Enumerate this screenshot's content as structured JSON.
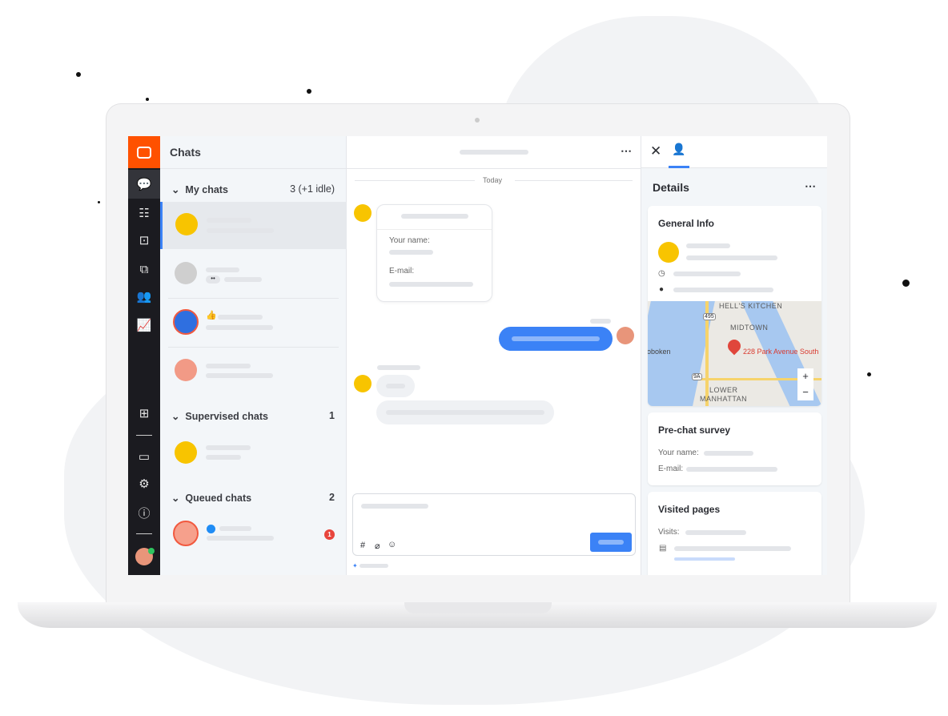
{
  "sidebar_nav": {
    "items": [
      "chats-icon",
      "list-icon",
      "inbox-icon",
      "ticket-icon",
      "team-icon",
      "reports-icon",
      "apps-icon",
      "billing-icon",
      "settings-icon",
      "help-icon"
    ],
    "accent": "#ff5100"
  },
  "chats": {
    "title": "Chats",
    "my_chats": {
      "label": "My chats",
      "count": "3 (+1 idle)"
    },
    "supervised": {
      "label": "Supervised chats",
      "count": "1"
    },
    "queued": {
      "label": "Queued chats",
      "count": "2",
      "badge": "1"
    }
  },
  "chat": {
    "date_divider": "Today",
    "form": {
      "name_label": "Your name:",
      "email_label": "E-mail:"
    },
    "accent": "#3b82f6"
  },
  "details": {
    "title": "Details",
    "general_info": "General Info",
    "map": {
      "address": "228 Park Avenue South",
      "labels": [
        "HELL'S KITCHEN",
        "MIDTOWN",
        "oboken",
        "LOWER",
        "MANHATTAN",
        "495",
        "9A"
      ],
      "zoom_in": "+",
      "zoom_out": "−"
    },
    "prechat": {
      "title": "Pre-chat survey",
      "name_label": "Your name:",
      "email_label": "E-mail:"
    },
    "visited": {
      "title": "Visited pages",
      "visits_label": "Visits:"
    }
  }
}
